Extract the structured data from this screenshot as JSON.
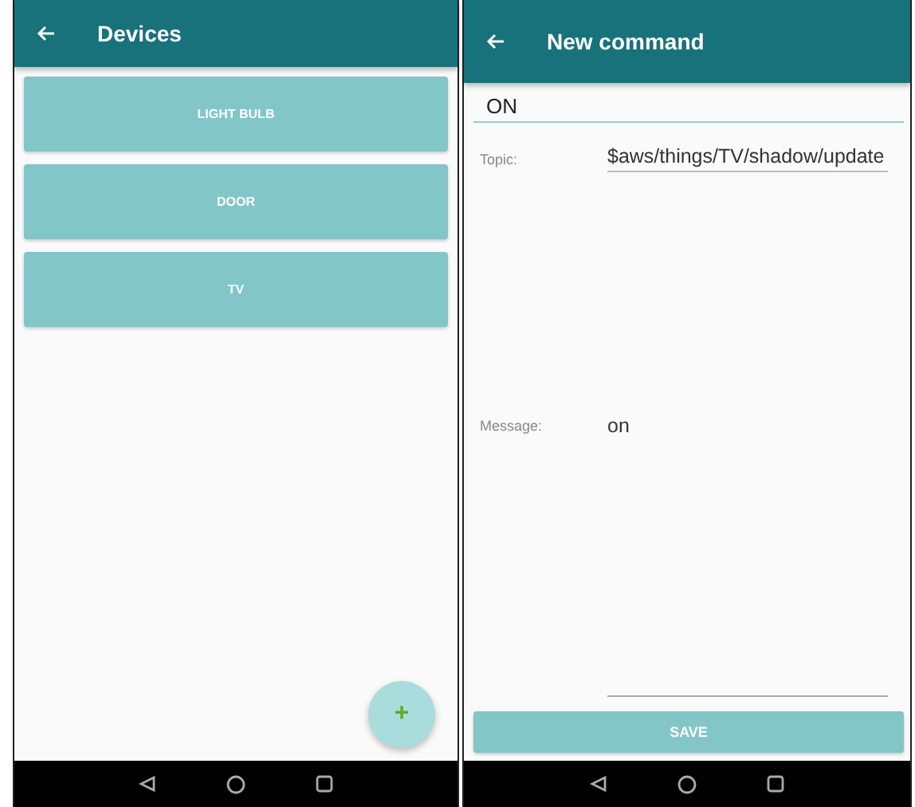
{
  "devices_screen": {
    "title": "Devices",
    "devices": [
      "LIGHT BULB",
      "DOOR",
      "TV"
    ],
    "fab": "+"
  },
  "command_screen": {
    "title": "New command",
    "name_value": "ON",
    "topic_label": "Topic:",
    "topic_value": "$aws/things/TV/shadow/update",
    "message_label": "Message:",
    "message_value": "on",
    "save_button": "SAVE"
  }
}
